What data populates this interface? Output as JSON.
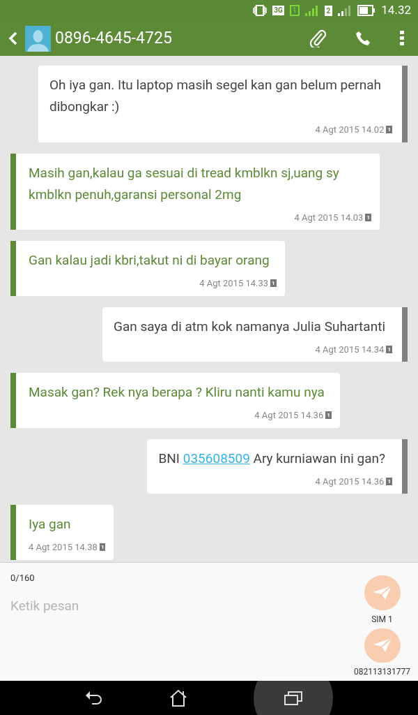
{
  "status_bar": {
    "network": "3G",
    "sims": [
      "1",
      "2"
    ],
    "time": "14.32"
  },
  "header": {
    "title": "0896-4645-4725"
  },
  "messages": [
    {
      "kind": "sent",
      "parts": [
        {
          "kind": "plain",
          "text": "Oh iya gan. Itu laptop masih segel kan gan belum pernah dibongkar :)"
        }
      ],
      "time": "4 Agt 2015 14.02",
      "sim": "1"
    },
    {
      "kind": "received",
      "parts": [
        {
          "kind": "plain",
          "text": "Masih gan,kalau ga sesuai di tread kmblkn sj,uang sy kmblkn penuh,garansi personal 2mg"
        }
      ],
      "time": "4 Agt 2015 14.03",
      "sim": "1"
    },
    {
      "kind": "received",
      "parts": [
        {
          "kind": "plain",
          "text": "Gan kalau jadi kbri,takut ni di bayar orang"
        }
      ],
      "time": "4 Agt 2015 14.33",
      "sim": "1"
    },
    {
      "kind": "sent",
      "parts": [
        {
          "kind": "plain",
          "text": "Gan saya di atm kok namanya Julia Suhartanti"
        }
      ],
      "time": "4 Agt 2015 14.34",
      "sim": "1"
    },
    {
      "kind": "received",
      "parts": [
        {
          "kind": "plain",
          "text": "Masak gan? Rek nya berapa ? Kliru nanti kamu nya"
        }
      ],
      "time": "4 Agt 2015 14.36",
      "sim": "1"
    },
    {
      "kind": "sent",
      "parts": [
        {
          "kind": "plain",
          "text": "BNI "
        },
        {
          "kind": "link",
          "text": "035608509"
        },
        {
          "kind": "plain",
          "text": " Ary kurniawan ini gan?"
        }
      ],
      "time": "4 Agt 2015 14.36",
      "sim": "1"
    },
    {
      "kind": "received",
      "parts": [
        {
          "kind": "plain",
          "text": "Iya gan"
        }
      ],
      "time": "4 Agt 2015 14.38",
      "sim": "1"
    }
  ],
  "composer": {
    "counter": "0/160",
    "placeholder": "Ketik pesan",
    "send_buttons": [
      {
        "label": "SIM 1"
      },
      {
        "label": "082113131777"
      }
    ]
  }
}
